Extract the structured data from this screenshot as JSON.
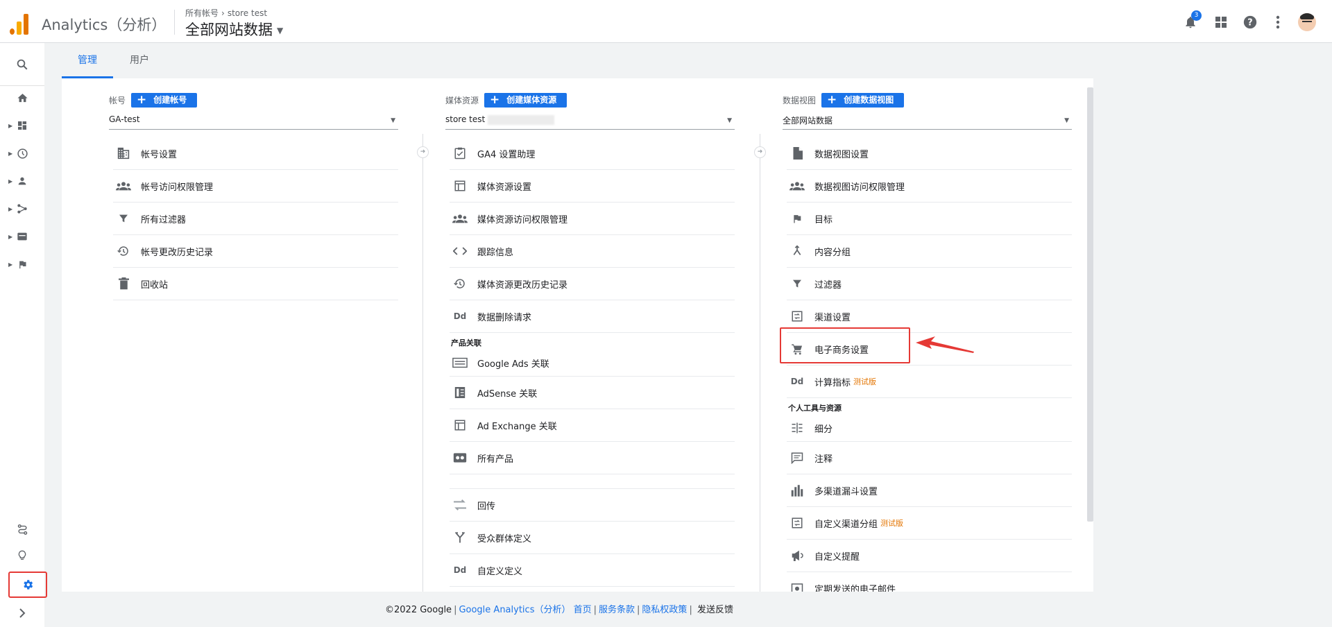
{
  "header": {
    "product_name": "Analytics（分析）",
    "breadcrumb_account": "所有帐号",
    "breadcrumb_property": "store test",
    "view_name": "全部网站数据",
    "notification_count": "3"
  },
  "tabs": [
    {
      "label": "管理",
      "active": true
    },
    {
      "label": "用户",
      "active": false
    }
  ],
  "account_col": {
    "label": "帐号",
    "create_label": "创建帐号",
    "selected": "GA-test",
    "items": [
      "帐号设置",
      "帐号访问权限管理",
      "所有过滤器",
      "帐号更改历史记录",
      "回收站"
    ]
  },
  "property_col": {
    "label": "媒体资源",
    "create_label": "创建媒体资源",
    "selected": "store test",
    "items": [
      "GA4 设置助理",
      "媒体资源设置",
      "媒体资源访问权限管理",
      "跟踪信息",
      "媒体资源更改历史记录",
      "数据删除请求"
    ],
    "section_product": "产品关联",
    "product_items": [
      "Google Ads 关联",
      "AdSense 关联",
      "Ad Exchange 关联",
      "所有产品"
    ],
    "more_items": [
      "回传",
      "受众群体定义",
      "自定义定义"
    ]
  },
  "view_col": {
    "label": "数据视图",
    "create_label": "创建数据视图",
    "selected": "全部网站数据",
    "items": [
      "数据视图设置",
      "数据视图访问权限管理",
      "目标",
      "内容分组",
      "过滤器",
      "渠道设置",
      "电子商务设置",
      "计算指标"
    ],
    "beta_label": "测试版",
    "section_personal": "个人工具与资源",
    "personal_items": [
      "细分",
      "注释",
      "多渠道漏斗设置",
      "自定义渠道分组",
      "自定义提醒",
      "定期发送的电子邮件"
    ]
  },
  "footer": {
    "copyright": "©2022 Google",
    "link_ga": "Google Analytics（分析）",
    "link_home": "首页",
    "link_terms": "服务条款",
    "link_privacy": "隐私权政策",
    "feedback": "发送反馈"
  },
  "colors": {
    "accent": "#1a73e8",
    "annotation_red": "#e53935",
    "logo_orange": "#f9ab00",
    "logo_dark_orange": "#e37400",
    "beta_orange": "#e37400"
  },
  "icons": {
    "top": [
      "notifications-icon",
      "apps-icon",
      "help-icon",
      "more-vert-icon",
      "avatar"
    ],
    "nav": [
      "search-icon",
      "home-icon",
      "customization-icon",
      "realtime-icon",
      "audience-icon",
      "acquisition-icon",
      "behavior-icon",
      "conversions-icon",
      "attribution-icon",
      "discover-icon",
      "admin-gear-icon",
      "expand-icon"
    ]
  }
}
